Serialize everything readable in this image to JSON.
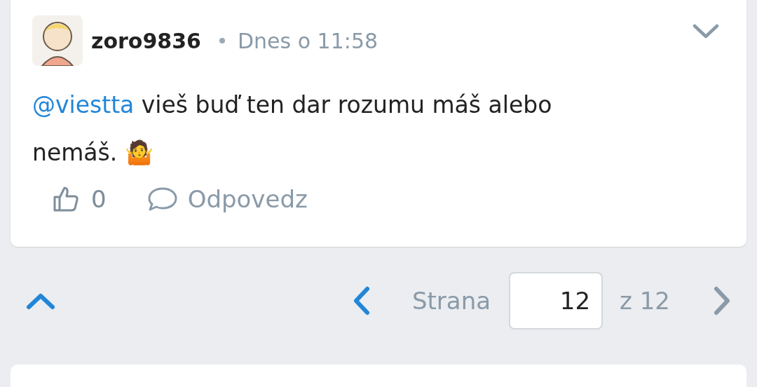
{
  "comment": {
    "author": "zoro9836",
    "time": "Dnes o 11:58",
    "mention": "@viestta",
    "text": "vieš buď ten dar rozumu máš alebo nemáš. 🤷",
    "likes": "0",
    "reply": "Odpovedz"
  },
  "pagination": {
    "label": "Strana",
    "page": "12",
    "of": "z 12",
    "prev": {
      "disabled": false
    },
    "next": {
      "disabled": true
    }
  }
}
